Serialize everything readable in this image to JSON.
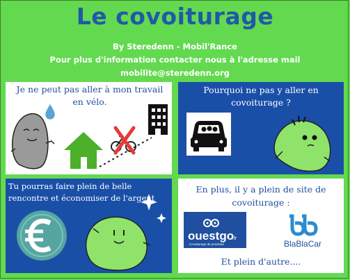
{
  "header": {
    "title": "Le covoiturage",
    "byline": "By Steredenn - Mobil'Rance",
    "info": "Pour plus d'information contacter nous à l'adresse mail",
    "email": "mobilite@steredenn.org"
  },
  "panels": {
    "work_bike": {
      "text": "Je ne peut pas aller à mon travail en vélo."
    },
    "carpool_question": {
      "text": "Pourquoi ne pas y aller en covoiturage ?"
    },
    "benefits": {
      "text": "Tu pourras faire plein de belle rencontre et économiser de l'argent"
    },
    "sites": {
      "text": "En plus, il y a plein de site de covoiturage :",
      "ouestgo_logo": "ouestgo",
      "ouestgo_tld": ".fr",
      "ouestgo_tagline": "Covoiturage de proximité",
      "blablacar_logo": "BlaBlaCar",
      "more": "Et plein d'autre...."
    }
  },
  "colors": {
    "background": "#63d94f",
    "title": "#1f5aa8",
    "panel_blue": "#1a4fa8",
    "blob_green": "#8fe36a",
    "ouestgo_blue": "#1f4f9e",
    "blablacar_blue": "#1f6fb0"
  },
  "icons": [
    "water-drop-icon",
    "house-icon",
    "bicycle-icon",
    "building-icon",
    "car-icon",
    "euro-coin-icon",
    "sparkle-icon"
  ]
}
